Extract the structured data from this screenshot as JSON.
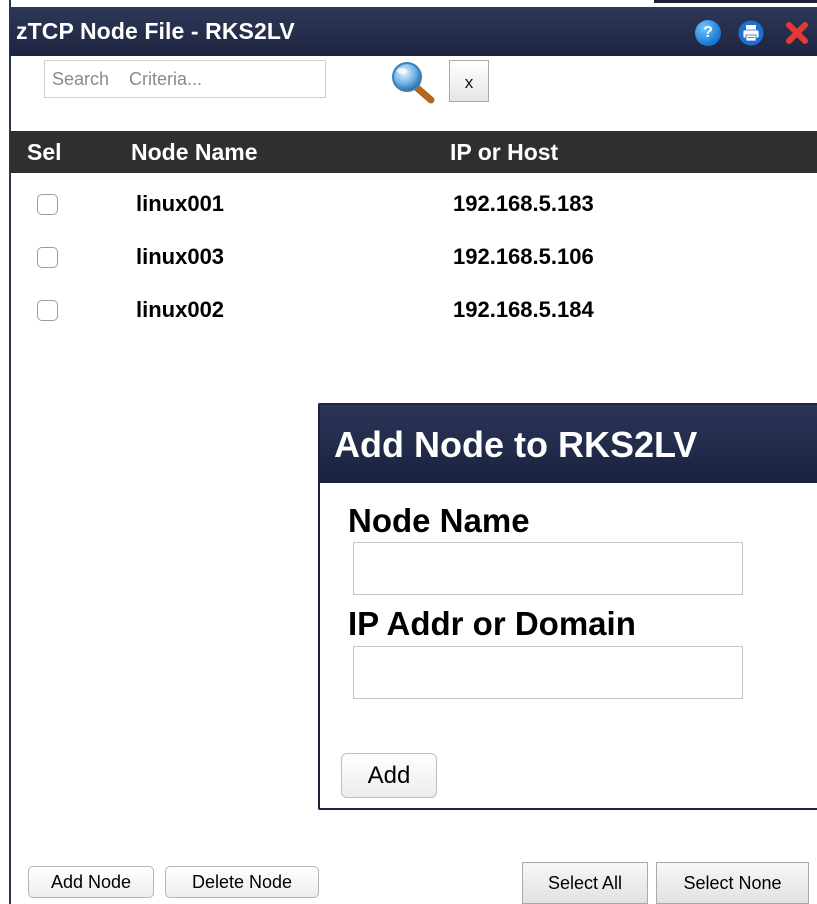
{
  "window": {
    "title": "zTCP Node File - RKS2LV"
  },
  "header_icons": {
    "help": "help-icon",
    "help_glyph": "?",
    "print": "printer-icon",
    "close": "close-icon"
  },
  "search": {
    "placeholder": "Search    Criteria...",
    "value": "",
    "clear_label": "x"
  },
  "table": {
    "columns": [
      "Sel",
      "Node Name",
      "IP or Host"
    ],
    "rows": [
      {
        "selected": false,
        "name": "linux001",
        "ip": "192.168.5.183"
      },
      {
        "selected": false,
        "name": "linux003",
        "ip": "192.168.5.106"
      },
      {
        "selected": false,
        "name": "linux002",
        "ip": "192.168.5.184"
      }
    ]
  },
  "dialog": {
    "title": "Add Node to RKS2LV",
    "node_name_label": "Node Name",
    "node_name_value": "",
    "ip_label": "IP Addr or Domain",
    "ip_value": "",
    "add_label": "Add"
  },
  "footer": {
    "add_node": "Add Node",
    "delete_node": "Delete Node",
    "select_all": "Select All",
    "select_none": "Select None"
  },
  "colors": {
    "titlebar": "#1d2440",
    "table_header": "#2f2f2f",
    "close_red": "#e53935"
  }
}
